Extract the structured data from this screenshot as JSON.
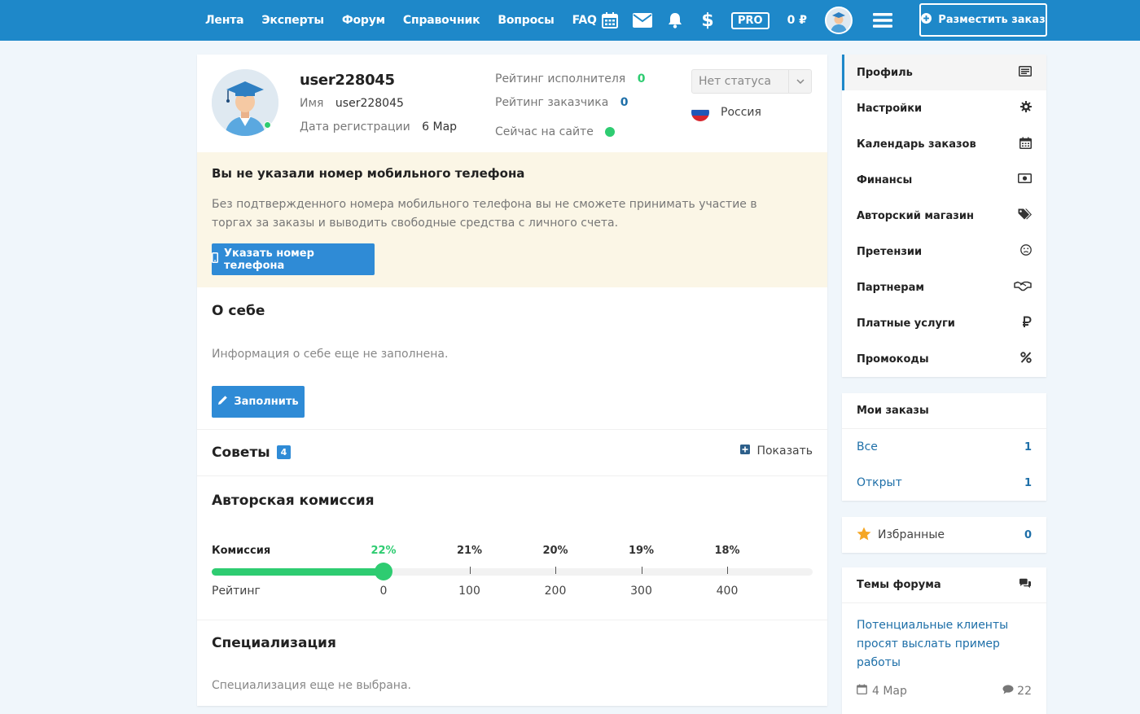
{
  "nav": {
    "items": [
      "Лента",
      "Эксперты",
      "Форум",
      "Справочник",
      "Вопросы",
      "FAQ"
    ],
    "pro_label": "PRO",
    "balance": "0 ₽",
    "place_order_label": "Разместить заказ"
  },
  "profile": {
    "username": "user228045",
    "name_label": "Имя",
    "name_value": "user228045",
    "reg_label": "Дата регистрации",
    "reg_value": "6 Мар",
    "exec_rating_label": "Рейтинг исполнителя",
    "exec_rating_value": "0",
    "cust_rating_label": "Рейтинг заказчика",
    "cust_rating_value": "0",
    "online_label": "Сейчас на сайте",
    "status_value": "Нет статуса",
    "country": "Россия"
  },
  "phone_warning": {
    "title": "Вы не указали номер мобильного телефона",
    "text": "Без подтвержденного номера мобильного телефона вы не сможете принимать участие в торгах за заказы и выводить свободные средства с личного счета.",
    "button_label": "Указать номер телефона"
  },
  "about": {
    "title": "О себе",
    "empty_text": "Информация о себе еще не заполнена.",
    "button_label": "Заполнить"
  },
  "tips": {
    "title": "Советы",
    "count": "4",
    "show_label": "Показать"
  },
  "commission": {
    "title": "Авторская комиссия",
    "commission_label": "Комиссия",
    "rating_label": "Рейтинг",
    "levels": [
      {
        "commission": "22%",
        "rating": "0"
      },
      {
        "commission": "21%",
        "rating": "100"
      },
      {
        "commission": "20%",
        "rating": "200"
      },
      {
        "commission": "19%",
        "rating": "300"
      },
      {
        "commission": "18%",
        "rating": "400"
      }
    ],
    "current_rating": 0,
    "active_color": "#2ecc71"
  },
  "specialization": {
    "title": "Специализация",
    "empty_text": "Специализация еще не выбрана."
  },
  "sidebar": {
    "menu": [
      {
        "label": "Профиль",
        "icon": "profile-card-icon"
      },
      {
        "label": "Настройки",
        "icon": "gear-icon"
      },
      {
        "label": "Календарь заказов",
        "icon": "calendar-icon"
      },
      {
        "label": "Финансы",
        "icon": "money-icon"
      },
      {
        "label": "Авторский магазин",
        "icon": "tags-icon"
      },
      {
        "label": "Претензии",
        "icon": "frown-icon"
      },
      {
        "label": "Партнерам",
        "icon": "handshake-icon"
      },
      {
        "label": "Платные услуги",
        "icon": "ruble-icon"
      },
      {
        "label": "Промокоды",
        "icon": "percent-icon"
      }
    ],
    "orders": {
      "title": "Мои заказы",
      "rows": [
        {
          "label": "Все",
          "count": "1"
        },
        {
          "label": "Открыт",
          "count": "1"
        }
      ]
    },
    "favorites": {
      "label": "Избранные",
      "count": "0"
    },
    "forum": {
      "title": "Темы форума",
      "topic": "Потенциальные клиенты просят выслать пример работы",
      "date": "4 Мар",
      "comments": "22"
    }
  },
  "colors": {
    "brand": "#1e88c9",
    "button": "#2f8bd6",
    "success": "#2ecc71",
    "warning_bg": "#fbf6e6"
  }
}
